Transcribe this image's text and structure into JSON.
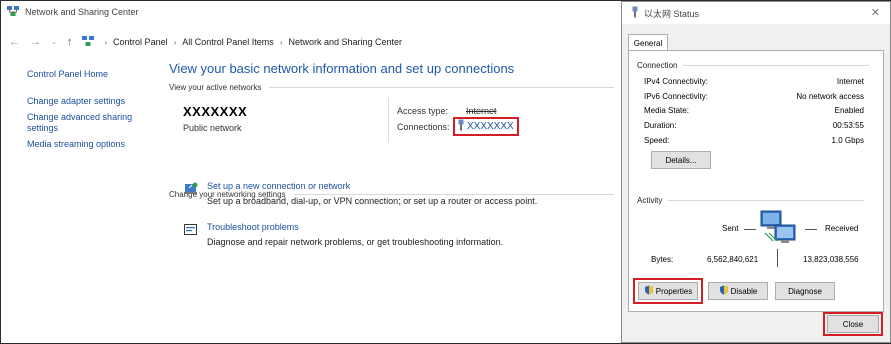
{
  "main_window": {
    "title": "Network and Sharing Center",
    "breadcrumb": [
      "Control Panel",
      "All Control Panel Items",
      "Network and Sharing Center"
    ],
    "sidebar": {
      "home": "Control Panel Home",
      "links": [
        "Change adapter settings",
        "Change advanced sharing settings",
        "Media streaming options"
      ]
    },
    "page_title": "View your basic network information and set up connections",
    "active_networks_label": "View your active networks",
    "network": {
      "name": "XXXXXXX",
      "type": "Public network",
      "access_type_label": "Access type:",
      "access_type_value": "Internet",
      "connections_label": "Connections:",
      "connection_name": "XXXXXXX"
    },
    "change_settings_label": "Change your networking settings",
    "tasks": [
      {
        "icon": "new-connection-icon",
        "link": "Set up a new connection or network",
        "desc": "Set up a broadband, dial-up, or VPN connection; or set up a router or access point."
      },
      {
        "icon": "troubleshoot-icon",
        "link": "Troubleshoot problems",
        "desc": "Diagnose and repair network problems, or get troubleshooting information."
      }
    ]
  },
  "dialog": {
    "title": "以太网 Status",
    "tab": "General",
    "connection_group": "Connection",
    "rows": [
      {
        "k": "IPv4 Connectivity:",
        "v": "Internet"
      },
      {
        "k": "IPv6 Connectivity:",
        "v": "No network access"
      },
      {
        "k": "Media State:",
        "v": "Enabled"
      },
      {
        "k": "Duration:",
        "v": "00:53:55"
      },
      {
        "k": "Speed:",
        "v": "1.0 Gbps"
      }
    ],
    "details_button": "Details...",
    "activity_group": "Activity",
    "sent_label": "Sent",
    "received_label": "Received",
    "bytes_label": "Bytes:",
    "bytes_sent": "6,562,840,621",
    "bytes_received": "13,823,038,556",
    "properties_button": "Properties",
    "disable_button": "Disable",
    "diagnose_button": "Diagnose",
    "close_button": "Close",
    "close_glyph": "✕"
  },
  "colors": {
    "link": "#1a4f9c",
    "title": "#1e5aa8",
    "highlight": "#d21f26"
  }
}
